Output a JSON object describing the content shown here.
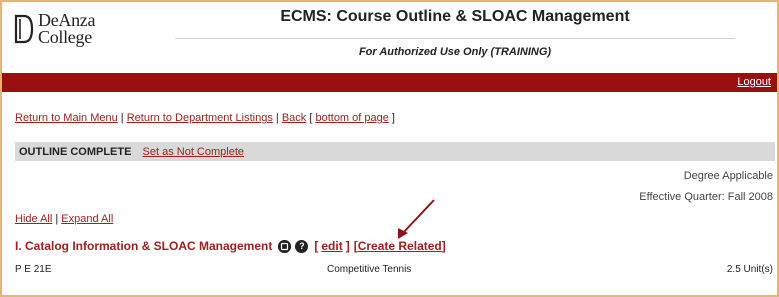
{
  "header": {
    "logo_line1": "DeAnza",
    "logo_line2": "College",
    "app_title": "ECMS: Course Outline & SLOAC Management",
    "subtitle": "For Authorized Use Only (TRAINING)"
  },
  "topbar": {
    "logout_label": "Logout",
    "bar_color": "#9a1010"
  },
  "nav": {
    "main_menu": "Return to Main Menu",
    "sep1": " | ",
    "dept_listings": "Return to Department Listings",
    "sep2": " | ",
    "back": "Back",
    "bottom_open": " [ ",
    "bottom_of_page": "bottom of page",
    "bottom_close": " ]"
  },
  "status": {
    "label": "OUTLINE COMPLETE",
    "action": "Set as Not Complete"
  },
  "info": {
    "degree": "Degree Applicable",
    "effective_quarter": "Effective Quarter: Fall 2008"
  },
  "toggles": {
    "hide_all": "Hide All",
    "sep": " | ",
    "expand_all": "Expand All"
  },
  "section": {
    "title": "I. Catalog Information & SLOAC Management",
    "icon1": "?",
    "icon2": "?",
    "edit_open": "[",
    "edit": "edit",
    "edit_close": "]",
    "create_open": "[",
    "create_related": "Create Related",
    "create_close": "]"
  },
  "course": {
    "code": "P E 21E",
    "name": "Competitive Tennis",
    "units": "2.5 Unit(s)"
  },
  "colors": {
    "accent_link": "#a02020",
    "status_bg": "#d9d9d9",
    "frame_border": "#e8b66a"
  }
}
